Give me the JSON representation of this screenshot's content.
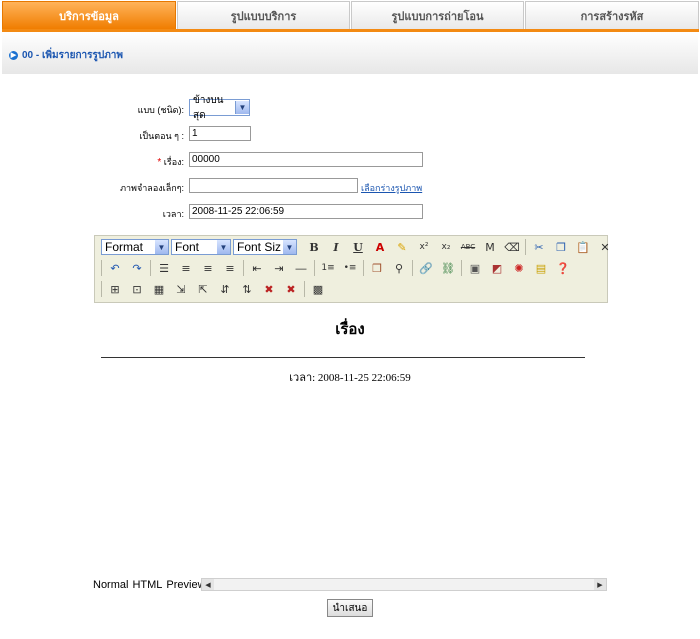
{
  "tabs": [
    "บริการข้อมูล",
    "รูปแบบบริการ",
    "รูปแบบการถ่ายโอน",
    "การสร้างรหัส"
  ],
  "breadcrumb": "00 - เพิ่มรายการรูปภาพ",
  "form": {
    "type_label": "แบบ (ชนิด):",
    "type_value": "ข้างบนสุด",
    "order_label": "เป็นตอน ๆ :",
    "order_value": "1",
    "required_mark": "*",
    "title_label": "เรื่อง:",
    "title_value": "00000",
    "image_label": "ภาพจำลองเล็กๆ:",
    "image_value": "",
    "image_link": "เลือกร่างรูปภาพ",
    "time_label": "เวลา:",
    "time_value": "2008-11-25 22:06:59"
  },
  "toolbar": {
    "format": "Format",
    "font": "Font",
    "font_size": "Font Siz"
  },
  "editor": {
    "heading": "เรื่อง",
    "time_line": "เวลา: 2008-11-25 22:06:59"
  },
  "modes": [
    "Normal",
    "HTML",
    "Preview"
  ],
  "submit_label": "นำเสนอ",
  "colors": {
    "accent": "#f38a13",
    "link": "#1a55b0"
  }
}
